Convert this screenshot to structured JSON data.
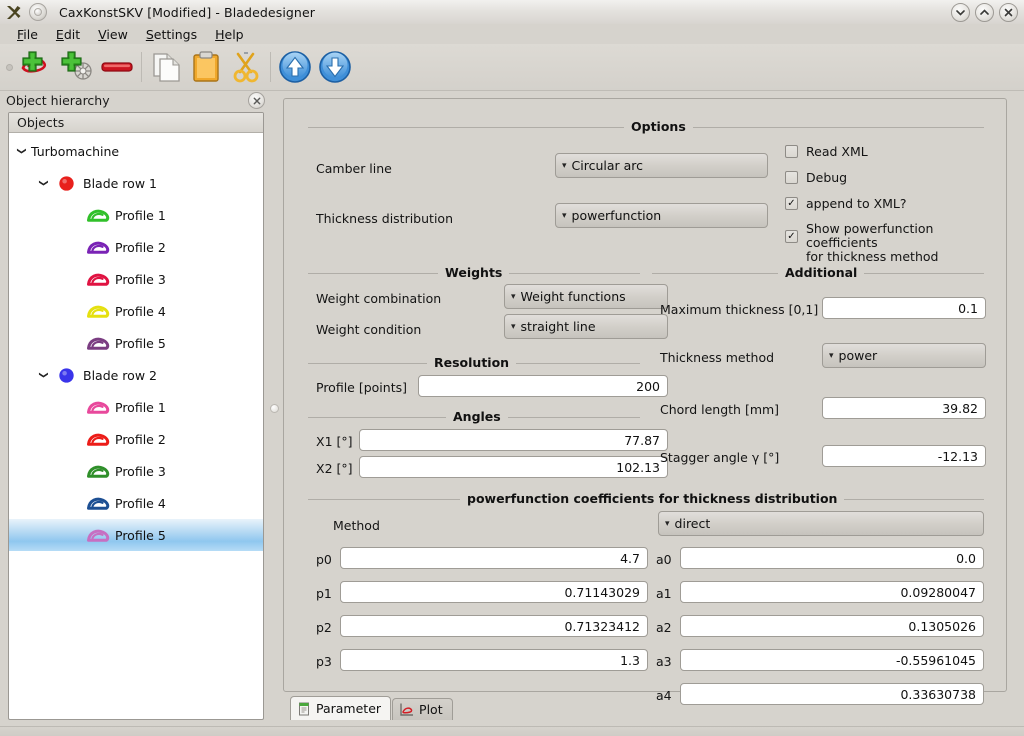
{
  "window": {
    "title": "CaxKonstSKV [Modified] - Bladedesigner",
    "app_icon": "x-logo-icon",
    "controls": [
      {
        "name": "minimize-button",
        "glyph": "chevron-down-icon"
      },
      {
        "name": "maximize-button",
        "glyph": "chevron-up-icon"
      },
      {
        "name": "close-button",
        "glyph": "close-icon"
      }
    ]
  },
  "menubar": {
    "items": [
      {
        "label": "File",
        "mnemonic": "F"
      },
      {
        "label": "Edit",
        "mnemonic": "E"
      },
      {
        "label": "View",
        "mnemonic": "V"
      },
      {
        "label": "Settings",
        "mnemonic": "S"
      },
      {
        "label": "Help",
        "mnemonic": "H"
      }
    ]
  },
  "toolbar": {
    "buttons": [
      {
        "name": "add-profile-button",
        "icon": "plus-blade-icon"
      },
      {
        "name": "add-blade-row-button",
        "icon": "plus-wheel-icon"
      },
      {
        "name": "remove-button",
        "icon": "minus-icon"
      },
      {
        "name": "copy-button",
        "icon": "copy-icon"
      },
      {
        "name": "paste-button",
        "icon": "clipboard-icon"
      },
      {
        "name": "cut-button",
        "icon": "scissors-icon"
      },
      {
        "name": "move-up-button",
        "icon": "arrow-up-circle-icon"
      },
      {
        "name": "move-down-button",
        "icon": "arrow-down-circle-icon"
      }
    ]
  },
  "dock": {
    "title": "Object hierarchy",
    "close_glyph": "×"
  },
  "tree": {
    "header": "Objects",
    "nodes": [
      {
        "label": "Turbomachine",
        "depth": 0,
        "twisty": "expanded",
        "icon": "none",
        "selected": false
      },
      {
        "label": "Blade row 1",
        "depth": 1,
        "twisty": "expanded",
        "icon": "blade-row-dot",
        "color": "#e8201c",
        "selected": false
      },
      {
        "label": "Profile 1",
        "depth": 2,
        "twisty": "none",
        "icon": "blade-profile",
        "color": "#31c02a",
        "selected": false
      },
      {
        "label": "Profile 2",
        "depth": 2,
        "twisty": "none",
        "icon": "blade-profile",
        "color": "#7a23b5",
        "selected": false
      },
      {
        "label": "Profile 3",
        "depth": 2,
        "twisty": "none",
        "icon": "blade-profile",
        "color": "#e01342",
        "selected": false
      },
      {
        "label": "Profile 4",
        "depth": 2,
        "twisty": "none",
        "icon": "blade-profile",
        "color": "#e5e010",
        "selected": false
      },
      {
        "label": "Profile 5",
        "depth": 2,
        "twisty": "none",
        "icon": "blade-profile",
        "color": "#7b3d82",
        "selected": false
      },
      {
        "label": "Blade row 2",
        "depth": 1,
        "twisty": "expanded",
        "icon": "blade-row-dot",
        "color": "#3a34ea",
        "selected": false
      },
      {
        "label": "Profile 1",
        "depth": 2,
        "twisty": "none",
        "icon": "blade-profile",
        "color": "#e8499c",
        "selected": false
      },
      {
        "label": "Profile 2",
        "depth": 2,
        "twisty": "none",
        "icon": "blade-profile",
        "color": "#ec1c18",
        "selected": false
      },
      {
        "label": "Profile 3",
        "depth": 2,
        "twisty": "none",
        "icon": "blade-profile",
        "color": "#2f8f2a",
        "selected": false
      },
      {
        "label": "Profile 4",
        "depth": 2,
        "twisty": "none",
        "icon": "blade-profile",
        "color": "#1d4f93",
        "selected": false
      },
      {
        "label": "Profile 5",
        "depth": 2,
        "twisty": "none",
        "icon": "blade-profile",
        "color": "#c76fc2",
        "selected": true
      }
    ]
  },
  "options": {
    "title": "Options",
    "camber_line_label": "Camber line",
    "camber_line_value": "Circular arc",
    "thickness_distribution_label": "Thickness distribution",
    "thickness_distribution_value": "powerfunction",
    "checkboxes": [
      {
        "label": "Read XML",
        "checked": false
      },
      {
        "label": "Debug",
        "checked": false
      },
      {
        "label": "append to XML?",
        "checked": true
      },
      {
        "label": "Show powerfunction coefficients\nfor thickness method",
        "checked": true
      }
    ]
  },
  "weights": {
    "title": "Weights",
    "combination_label": "Weight combination",
    "combination_value": "Weight functions",
    "condition_label": "Weight condition",
    "condition_value": "straight line"
  },
  "resolution": {
    "title": "Resolution",
    "profile_label": "Profile [points]",
    "profile_value": "200"
  },
  "angles": {
    "title": "Angles",
    "x1_label": "X1 [°]",
    "x1_value": "77.87",
    "x2_label": "X2 [°]",
    "x2_value": "102.13"
  },
  "additional": {
    "title": "Additional",
    "max_thickness_label": "Maximum thickness [0,1]",
    "max_thickness_value": "0.1",
    "thickness_method_label": "Thickness method",
    "thickness_method_value": "power",
    "chord_length_label": "Chord length [mm]",
    "chord_length_value": "39.82",
    "stagger_angle_label": "Stagger angle γ [°]",
    "stagger_angle_value": "-12.13"
  },
  "coefficients": {
    "title": "powerfunction coefficients for thickness distribution",
    "method_label": "Method",
    "method_value": "direct",
    "p": [
      {
        "label": "p0",
        "value": "4.7"
      },
      {
        "label": "p1",
        "value": "0.71143029"
      },
      {
        "label": "p2",
        "value": "0.71323412"
      },
      {
        "label": "p3",
        "value": "1.3"
      }
    ],
    "a": [
      {
        "label": "a0",
        "value": "0.0"
      },
      {
        "label": "a1",
        "value": "0.09280047"
      },
      {
        "label": "a2",
        "value": "0.1305026"
      },
      {
        "label": "a3",
        "value": "-0.55961045"
      },
      {
        "label": "a4",
        "value": "0.33630738"
      }
    ]
  },
  "tabs": [
    {
      "label": "Parameter",
      "icon": "notepad-icon",
      "active": true
    },
    {
      "label": "Plot",
      "icon": "plot-axes-icon",
      "active": false
    }
  ]
}
